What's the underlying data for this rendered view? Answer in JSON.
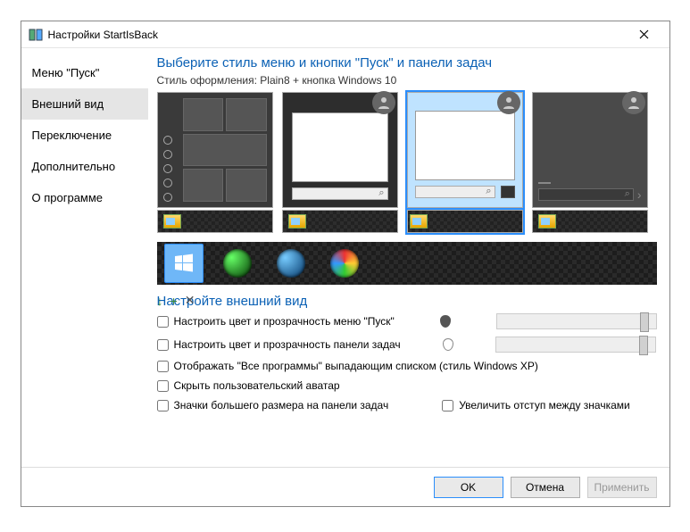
{
  "window": {
    "title": "Настройки StartIsBack"
  },
  "sidebar": {
    "items": [
      {
        "label": "Меню \"Пуск\""
      },
      {
        "label": "Внешний вид"
      },
      {
        "label": "Переключение"
      },
      {
        "label": "Дополнительно"
      },
      {
        "label": "О программе"
      }
    ],
    "selected": 1
  },
  "heading": "Выберите стиль меню и кнопки \"Пуск\" и панели задач",
  "style_label": "Стиль оформления:",
  "style_value": "Plain8 + кнопка Windows 10",
  "appearance_heading": "Настройте внешний вид",
  "toolicons": {
    "download": "↓",
    "add": "+",
    "close": "✕"
  },
  "options": {
    "color_menu": "Настроить цвет и прозрачность меню \"Пуск\"",
    "color_taskbar": "Настроить цвет и прозрачность панели задач",
    "all_programs": "Отображать \"Все программы\" выпадающим списком (стиль Windows XP)",
    "hide_avatar": "Скрыть пользовательский аватар",
    "large_icons": "Значки большего размера на панели задач",
    "increase_spacing": "Увеличить отступ между значками"
  },
  "buttons": {
    "ok": "OK",
    "cancel": "Отмена",
    "apply": "Применить"
  },
  "colors": {
    "drop_filled": "#555",
    "drop_outline": "#bbb"
  }
}
